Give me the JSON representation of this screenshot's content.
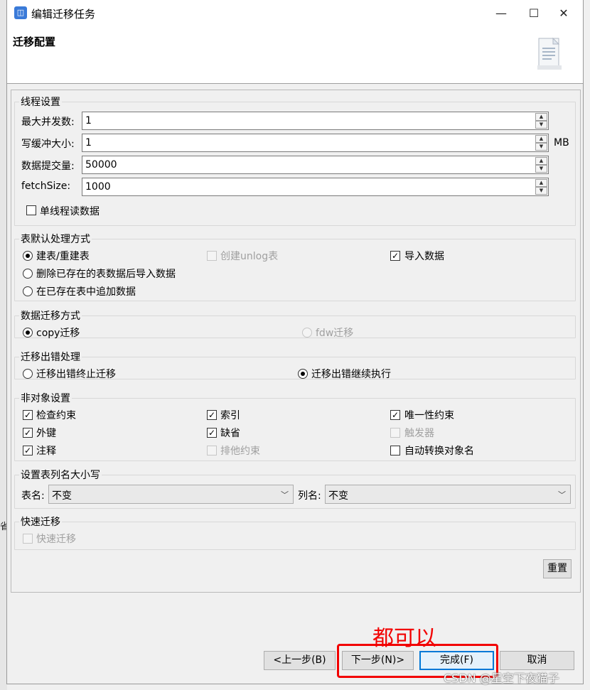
{
  "window": {
    "title": "编辑迁移任务",
    "header_title": "迁移配置",
    "controls": {
      "minimize": "—",
      "maximize": "☐",
      "close": "✕"
    }
  },
  "background": {
    "left_text": "省"
  },
  "thread": {
    "legend": "线程设置",
    "max_concurrency": {
      "label": "最大并发数:",
      "value": "1"
    },
    "write_buffer": {
      "label": "写缓冲大小:",
      "value": "1",
      "unit": "MB"
    },
    "batch_commit": {
      "label": "数据提交量:",
      "value": "50000"
    },
    "fetch_size": {
      "label": "fetchSize:",
      "value": "1000"
    },
    "single_thread_read": {
      "label": "单线程读数据",
      "checked": false
    }
  },
  "table_default": {
    "legend": "表默认处理方式",
    "create_rebuild": "建表/重建表",
    "create_unlog": "创建unlog表",
    "import_data": "导入数据",
    "delete_then_import": "删除已存在的表数据后导入数据",
    "append_existing": "在已存在表中追加数据"
  },
  "migration_mode": {
    "legend": "数据迁移方式",
    "copy": "copy迁移",
    "fdw": "fdw迁移"
  },
  "error_handling": {
    "legend": "迁移出错处理",
    "stop": "迁移出错终止迁移",
    "continue": "迁移出错继续执行"
  },
  "non_object": {
    "legend": "非对象设置",
    "check_constraint": "检查约束",
    "index": "索引",
    "unique_constraint": "唯一性约束",
    "foreign_key": "外键",
    "default": "缺省",
    "trigger": "触发器",
    "comment": "注释",
    "exclude_constraint": "排他约束",
    "auto_convert_case": "自动转换对象名"
  },
  "case_setting": {
    "legend": "设置表列名大小写",
    "table_label": "表名:",
    "table_value": "不变",
    "column_label": "列名:",
    "column_value": "不变"
  },
  "fast_migration": {
    "legend": "快速迁移",
    "option": "快速迁移"
  },
  "buttons": {
    "reset": "重置",
    "back": "<上一步(B)",
    "next": "下一步(N)>",
    "finish": "完成(F)",
    "cancel": "取消"
  },
  "annotation": {
    "text": "都可以",
    "color": "#f20000"
  },
  "watermark": "CSDN @星空下夜猫子",
  "colors": {
    "focus_border": "#0078d7",
    "app_icon": "#3a7ad8"
  }
}
